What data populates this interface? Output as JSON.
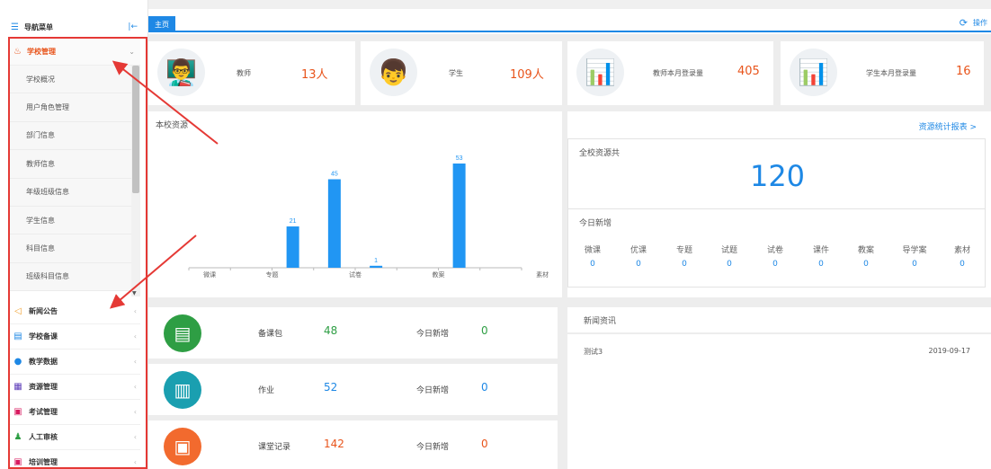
{
  "sidebar": {
    "title": "导航菜单",
    "active_group": "学校管理",
    "sub_items": [
      "学校概况",
      "用户角色管理",
      "部门信息",
      "教师信息",
      "年级班级信息",
      "学生信息",
      "科目信息",
      "班级科目信息"
    ],
    "groups": [
      {
        "label": "新闻公告",
        "icon": "speaker-icon"
      },
      {
        "label": "学校备课",
        "icon": "book-icon"
      },
      {
        "label": "教学数据",
        "icon": "chart-icon"
      },
      {
        "label": "资源管理",
        "icon": "grid-icon"
      },
      {
        "label": "考试管理",
        "icon": "exam-icon"
      },
      {
        "label": "人工审核",
        "icon": "people-icon"
      },
      {
        "label": "培训管理",
        "icon": "training-icon"
      }
    ]
  },
  "tabs": {
    "home": "主页",
    "actions": "操作"
  },
  "stats": [
    {
      "label": "教师",
      "value": "13人"
    },
    {
      "label": "学生",
      "value": "109人"
    },
    {
      "label": "教师本月登录量",
      "value": "405"
    },
    {
      "label": "学生本月登录量",
      "value": "16"
    }
  ],
  "chart_data": {
    "type": "bar",
    "title": "本校资源",
    "categories": [
      "微课",
      "专题",
      "试卷",
      "教案",
      "素材"
    ],
    "values": [
      21,
      45,
      1,
      53
    ],
    "bar_slots": [
      2,
      3,
      4,
      6
    ],
    "slot_count": 8,
    "label_slots": [
      0.5,
      2,
      4,
      6,
      8.5
    ]
  },
  "summary": {
    "link": "资源统计报表 >",
    "total_label": "全校资源共",
    "total": "120",
    "today_label": "今日新增",
    "categories": [
      {
        "name": "微课",
        "value": "0"
      },
      {
        "name": "优课",
        "value": "0"
      },
      {
        "name": "专题",
        "value": "0"
      },
      {
        "name": "试题",
        "value": "0"
      },
      {
        "name": "试卷",
        "value": "0"
      },
      {
        "name": "课件",
        "value": "0"
      },
      {
        "name": "教案",
        "value": "0"
      },
      {
        "name": "导学案",
        "value": "0"
      },
      {
        "name": "素材",
        "value": "0"
      }
    ]
  },
  "resources": [
    {
      "name": "备课包",
      "value": "48",
      "today_label": "今日新增",
      "today": "0",
      "color": "#2e9e44",
      "value_color": "#2e9e44",
      "icon": "document-icon"
    },
    {
      "name": "作业",
      "value": "52",
      "today_label": "今日新增",
      "today": "0",
      "color": "#1a9fb0",
      "value_color": "#1e88e5",
      "icon": "homework-icon"
    },
    {
      "name": "课堂记录",
      "value": "142",
      "today_label": "今日新增",
      "today": "0",
      "color": "#f26a2e",
      "value_color": "#e8541b",
      "icon": "classroom-icon"
    }
  ],
  "news": {
    "title": "新闻资讯",
    "items": [
      {
        "title": "测试3",
        "date": "2019-09-17"
      }
    ]
  },
  "colors": {
    "accent": "#1e88e5",
    "orange": "#e8541b",
    "red": "#e53935"
  }
}
